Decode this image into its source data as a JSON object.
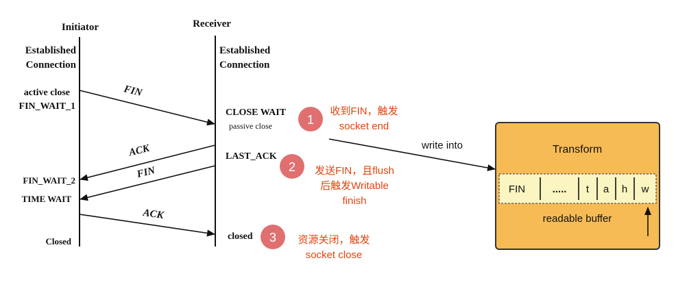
{
  "colors": {
    "line": "#111111",
    "step_circle": "#e07070",
    "note_text": "#e0440e",
    "transform_fill": "#f7bb55",
    "transform_border": "#333333",
    "buffer_fill": "#fbf5c2"
  },
  "lanes": {
    "initiator": "Initiator",
    "receiver": "Receiver"
  },
  "initiator_states": {
    "established_1": "Established",
    "established_2": "Connection",
    "active_close": "active close",
    "fin_wait_1": "FIN_WAIT_1",
    "fin_wait_2": "FIN_WAIT_2",
    "time_wait": "TIME WAIT",
    "closed": "Closed"
  },
  "receiver_states": {
    "established_1": "Established",
    "established_2": "Connection",
    "close_wait": "CLOSE WAIT",
    "passive_close": "passive close",
    "last_ack": "LAST_ACK",
    "closed": "closed"
  },
  "messages": {
    "fin_1": "FIN",
    "ack_1": "ACK",
    "fin_2": "FIN",
    "ack_2": "ACK"
  },
  "steps": [
    {
      "number": "1",
      "line1": "收到FIN，触发",
      "line2": "socket end"
    },
    {
      "number": "2",
      "line1": "发送FIN，且flush",
      "line2": "后触发Writable",
      "line3": "finish"
    },
    {
      "number": "3",
      "line1": "资源关闭，触发",
      "line2": "socket close"
    }
  ],
  "write_into": "write into",
  "transform": {
    "title": "Transform",
    "buffer_label": "readable buffer",
    "cells": [
      "FIN",
      ".....",
      "t",
      "a",
      "h",
      "w"
    ]
  }
}
